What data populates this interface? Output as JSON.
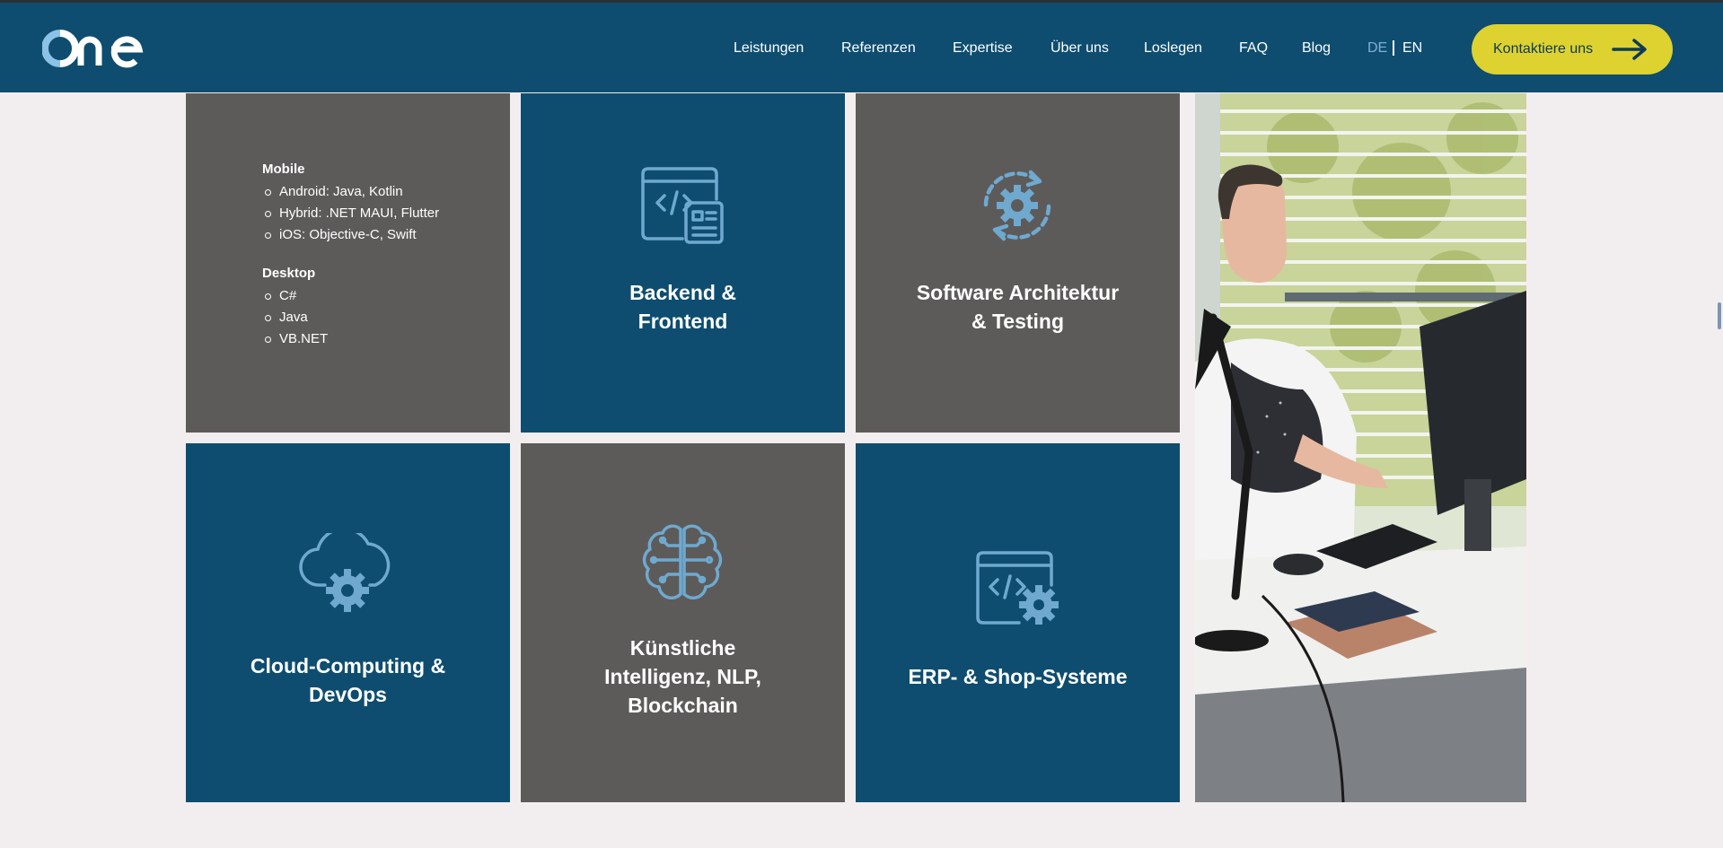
{
  "header": {
    "logo_text": "one",
    "nav": [
      "Leistungen",
      "Referenzen",
      "Expertise",
      "Über uns",
      "Loslegen",
      "FAQ",
      "Blog"
    ],
    "lang_de": "DE",
    "lang_en": "EN",
    "cta_label": "Kontaktiere uns"
  },
  "tiles": {
    "languages": {
      "mobile_heading": "Mobile",
      "mobile_items": [
        "Android: Java, Kotlin",
        "Hybrid: .NET MAUI, Flutter",
        "iOS: Objective-C, Swift"
      ],
      "desktop_heading": "Desktop",
      "desktop_items": [
        "C#",
        "Java",
        "VB.NET"
      ]
    },
    "backend": {
      "line1": "Backend &",
      "line2": "Frontend",
      "icon": "code-window-icon"
    },
    "architecture": {
      "line1": "Software Architektur",
      "line2": "& Testing",
      "icon": "gear-cycle-icon"
    },
    "cloud": {
      "line1": "Cloud-Computing &",
      "line2": "DevOps",
      "icon": "cloud-gear-icon"
    },
    "ai": {
      "line1": "Künstliche",
      "line2": "Intelligenz, NLP,",
      "line3": "Blockchain",
      "icon": "brain-circuit-icon"
    },
    "erp": {
      "line1": "ERP- & Shop-Systeme",
      "icon": "code-window-gear-icon"
    }
  },
  "colors": {
    "header_bg": "#0e4d70",
    "tile_blue": "#0e4d70",
    "tile_gray": "#5d5b5a",
    "icon_blue": "#6fa9cf",
    "cta_bg": "#ddd230",
    "page_bg": "#f2eeef"
  }
}
